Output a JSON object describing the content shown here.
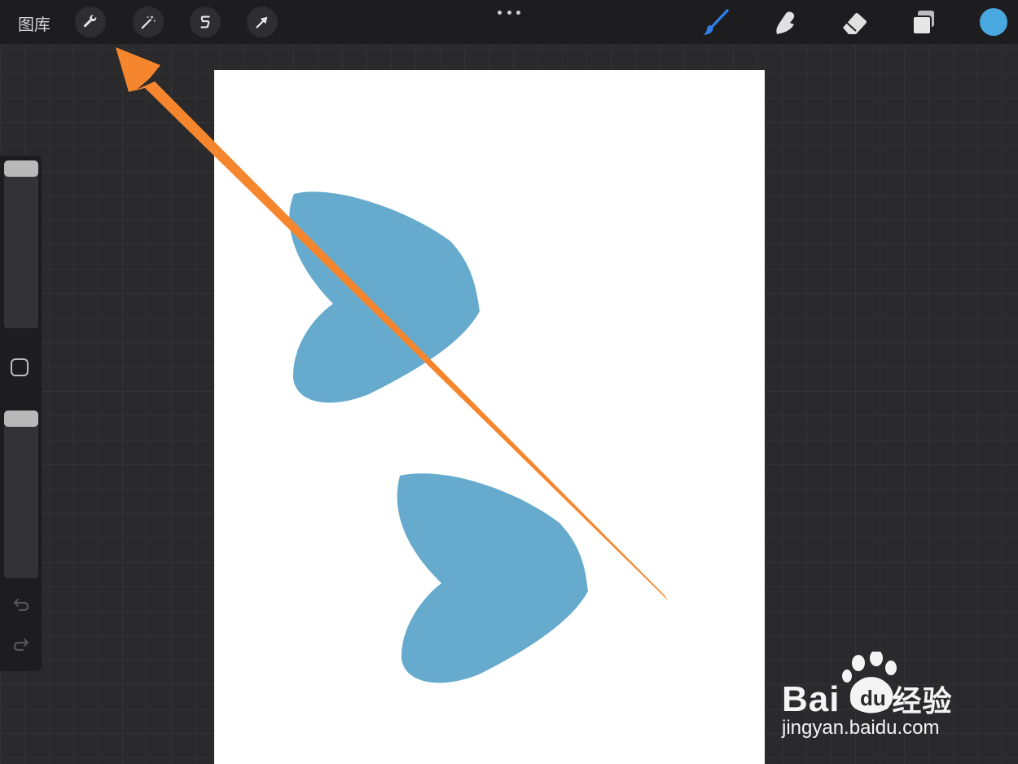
{
  "toolbar": {
    "gallery_label": "图库",
    "left_tools": [
      {
        "name": "actions",
        "icon": "wrench-icon"
      },
      {
        "name": "adjustments",
        "icon": "magic-wand-icon"
      },
      {
        "name": "selection",
        "icon": "selection-s-icon"
      },
      {
        "name": "transform",
        "icon": "transform-arrow-icon"
      }
    ],
    "more_icon": "more-dots-icon",
    "right_tools": [
      {
        "name": "brush",
        "icon": "brush-icon",
        "active": true
      },
      {
        "name": "smudge",
        "icon": "smudge-icon"
      },
      {
        "name": "eraser",
        "icon": "eraser-icon"
      },
      {
        "name": "layers",
        "icon": "layers-icon"
      }
    ],
    "current_color": "#4aa8e0",
    "active_tool_color": "#2f7fe6"
  },
  "sidebar": {
    "size_slider_icon": "brush-size-slider",
    "modify_button_icon": "square-modify-icon",
    "opacity_slider_icon": "opacity-slider",
    "undo_icon": "undo-icon",
    "redo_icon": "redo-icon"
  },
  "canvas": {
    "shape_color": "#66aacd",
    "shape_icon": "heart-shape"
  },
  "annotation": {
    "arrow_color": "#f5862e",
    "arrow_icon": "orange-arrow-icon"
  },
  "watermark": {
    "brand": "Bai",
    "brand_suffix": "经验",
    "paw_text": "du",
    "url": "jingyan.baidu.com"
  }
}
